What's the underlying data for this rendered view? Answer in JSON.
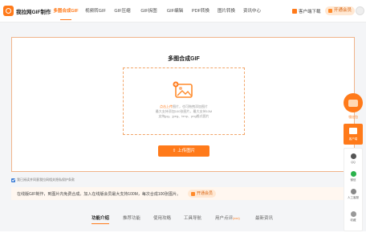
{
  "header": {
    "brand": "我拉网GIF制作",
    "nav": [
      {
        "label": "多图合成GIF",
        "active": true
      },
      {
        "label": "视频转GIF",
        "active": false
      },
      {
        "label": "GIF压缩",
        "active": false
      },
      {
        "label": "GIF拆图",
        "active": false
      },
      {
        "label": "GIF编辑",
        "active": false
      },
      {
        "label": "PDF转换",
        "active": false
      },
      {
        "label": "图片转换",
        "active": false
      },
      {
        "label": "资讯中心",
        "active": false
      }
    ],
    "client_download": "客户端下载",
    "vip_button": "开通会员"
  },
  "main": {
    "title": "多图合成GIF",
    "drop_hint_highlight": "点击上传",
    "drop_hint_rest": "图片，也可拖拽添加图片",
    "drop_line2": "最大支持添加100张图片，最大支持10M",
    "drop_line3": "支持jpg、jpeg、bmp、png格式图片",
    "upload_button": "上传图片",
    "upload_icon": "upload-arrow-icon"
  },
  "agreement": "我已阅读并同意我拉网相关隐私保护条款",
  "notice": {
    "text": "在线版GIF制作，到图片内免费合成。加入在线版会员最大支持100M，每次合成100张图片。",
    "vip_button": "开通会员"
  },
  "tabs": [
    {
      "label": "功能介绍",
      "active": true
    },
    {
      "label": "推荐功能",
      "active": false
    },
    {
      "label": "使用攻略",
      "active": false
    },
    {
      "label": "工具导航",
      "active": false
    },
    {
      "label": "用户点评",
      "badge": "(xxx)",
      "active": false
    },
    {
      "label": "最新资讯",
      "active": false
    }
  ],
  "float_panel": {
    "top_label": "领红包",
    "selected_label": "客户端",
    "items": [
      {
        "label": "QQ",
        "icon": "qq-icon",
        "color": "#555555"
      },
      {
        "label": "微信",
        "icon": "wechat-icon",
        "color": "#2bb24c"
      },
      {
        "label": "人工客服",
        "icon": "service-icon",
        "color": "#888888"
      },
      {
        "label": "收藏",
        "icon": "star-icon",
        "color": "#999999"
      }
    ]
  },
  "colors": {
    "accent": "#ff7a1a",
    "border": "#f0b48a"
  }
}
